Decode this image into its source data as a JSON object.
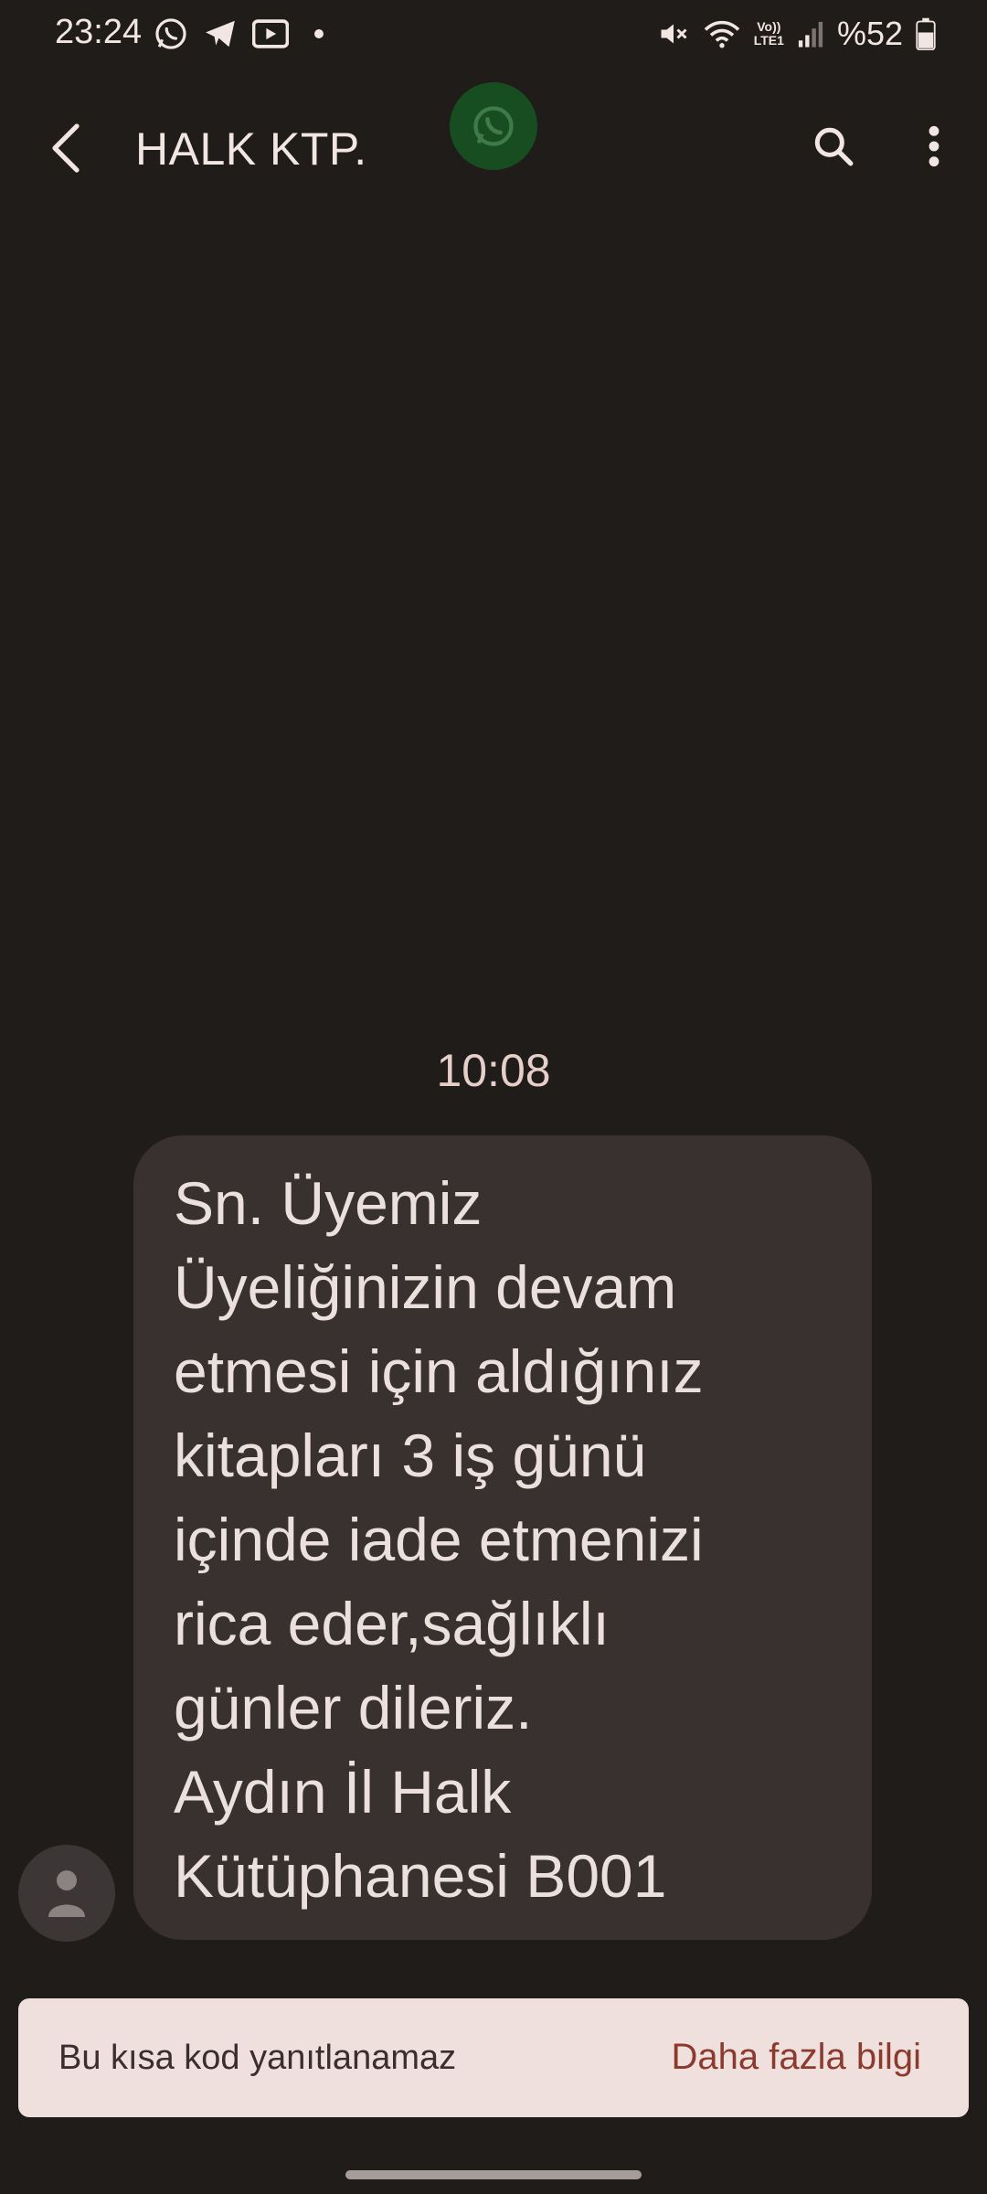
{
  "status_bar": {
    "time": "23:24",
    "battery": "%52",
    "network_label_top": "Vo))",
    "network_label_bottom": "LTE1",
    "left_icons": [
      "whatsapp-icon",
      "telegram-icon",
      "youtube-icon",
      "dot-icon"
    ],
    "right_icons": [
      "mute-icon",
      "wifi-icon",
      "signal-icon",
      "battery-icon"
    ]
  },
  "app_bar": {
    "title": "HALK KTP.",
    "icons": [
      "back-arrow-icon",
      "whatsapp-icon",
      "search-icon",
      "more-vert-icon"
    ]
  },
  "conversation": {
    "timestamp": "10:08",
    "message": "Sn. Üyemiz\nÜyeliğinizin  devam\netmesi için  aldığınız\nkitapları 3 iş günü\niçinde iade etmenizi\nrica eder,sağlıklı\ngünler dileriz.\nAydın İl Halk\nKütüphanesi B001",
    "avatar_icon": "person-icon"
  },
  "info_bar": {
    "text": "Bu kısa kod yanıtlanamaz",
    "link": "Daha fazla bilgi"
  },
  "colors": {
    "background": "#201c1a",
    "bubble": "#39312f",
    "info_bar": "#efe0de",
    "link": "#8d3a2e",
    "whatsapp_bubble": "#174d21"
  }
}
